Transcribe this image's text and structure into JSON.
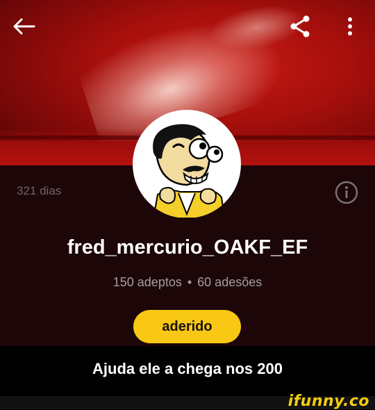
{
  "profile": {
    "days": "321 dias",
    "username": "fred_mercurio_OAKF_EF",
    "followers": "150 adeptos",
    "separator": "•",
    "joins": "60 adesões",
    "join_button": "aderido"
  },
  "caption": "Ajuda ele a chega nos 200",
  "watermark": "ifunny.co",
  "icons": {
    "back": "arrow-left-icon",
    "share": "share-icon",
    "more": "more-vertical-icon",
    "info": "info-icon"
  },
  "colors": {
    "accent": "#f9c814",
    "panel": "#1c0608",
    "banner": "#b5120e"
  }
}
